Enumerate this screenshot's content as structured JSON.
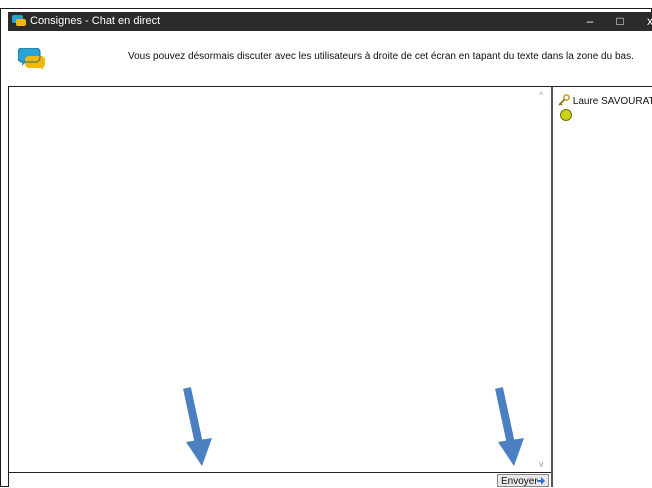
{
  "window": {
    "title": "Consignes - Chat en direct",
    "controls": {
      "minimize": "–",
      "maximize": "□",
      "close": "x"
    }
  },
  "header": {
    "message": "Vous pouvez désormais discuter avec les utilisateurs à droite de cet écran en tapant du texte dans la zone du bas."
  },
  "scrollbar": {
    "up": "^",
    "down": "v"
  },
  "users": [
    {
      "name": "Laure SAVOURAT",
      "icon": "key-icon",
      "status_color": "#c8d21b"
    }
  ],
  "input": {
    "value": "",
    "placeholder": ""
  },
  "send_button": {
    "label": "Envoyer"
  },
  "colors": {
    "titlebar": "#2b2b2b",
    "annotation_arrow": "#4a7fc1"
  }
}
